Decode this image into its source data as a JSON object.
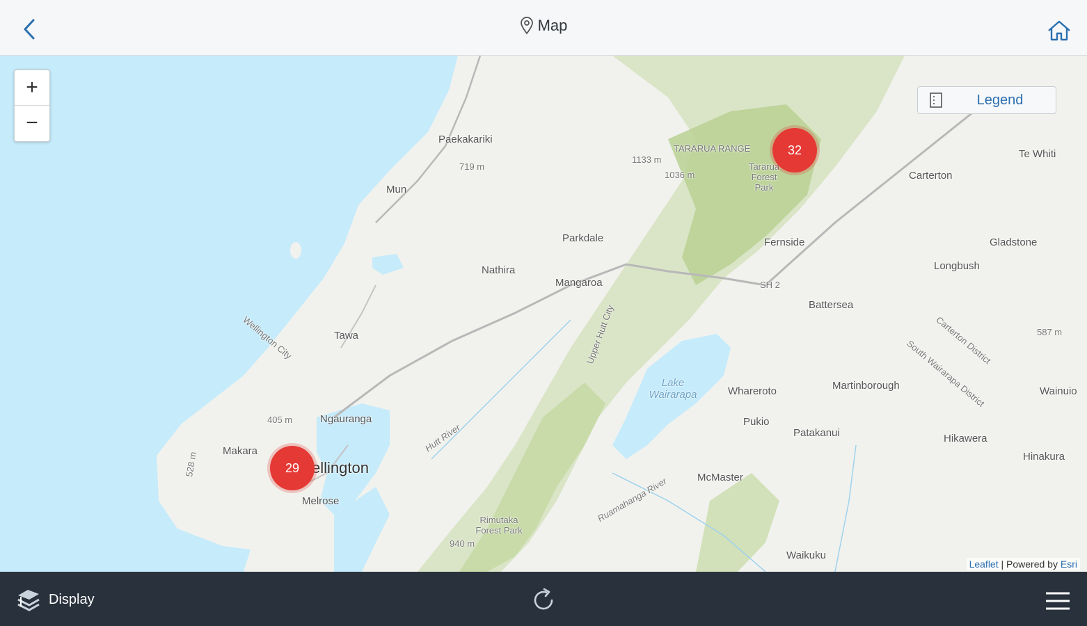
{
  "header": {
    "title": "Map"
  },
  "map": {
    "zoom_in_label": "+",
    "zoom_out_label": "−",
    "legend_label": "Legend",
    "clusters": [
      {
        "count": "32"
      },
      {
        "count": "29"
      }
    ],
    "places": {
      "paekakariki": "Paekakariki",
      "elev_719": "719 m",
      "mun": "Mun",
      "tararua_range": "TARARUA RANGE",
      "elev_1133": "1133 m",
      "elev_1036": "1036 m",
      "tararua_forest_park": "Tararua Forest Park",
      "parkdale": "Parkdale",
      "nathira": "Nathira",
      "mangaroa": "Mangaroa",
      "fernside": "Fernside",
      "carterton": "Carterton",
      "te_whiti": "Te Whiti",
      "gladstone": "Gladstone",
      "longbush": "Longbush",
      "sh2": "SH 2",
      "battersea": "Battersea",
      "tawa": "Tawa",
      "wellington_city": "Wellington City",
      "upper_hutt_city": "Upper Hutt City",
      "lake_wairarapa": "Lake Wairarapa",
      "whareroto": "Whareroto",
      "martinborough": "Martinborough",
      "pukio": "Pukio",
      "patakanui": "Patakanui",
      "hikawera": "Hikawera",
      "hinakura": "Hinakura",
      "wainuio": "Wainuio",
      "carterton_district": "Carterton District",
      "south_wairarapa_district": "South Wairarapa District",
      "elev_587": "587 m",
      "elev_405": "405 m",
      "ngauranga": "Ngauranga",
      "makara": "Makara",
      "wellington": "ellington",
      "melrose": "Melrose",
      "elev_528": "528 m",
      "mcmaster": "McMaster",
      "ruamahanga_river": "Ruamahanga River",
      "rimutaka_forest_park": "Rimutaka Forest Park",
      "elev_940": "940 m",
      "waikuku": "Waikuku",
      "hutt_river": "Hutt River"
    },
    "attribution": {
      "leaflet": "Leaflet",
      "separator": " | Powered by ",
      "esri": "Esri"
    }
  },
  "footer": {
    "display_label": "Display"
  },
  "colors": {
    "accent": "#2a6fb0",
    "cluster": "#e53935",
    "footer_bg": "#29323c",
    "water": "#c6ebfb"
  },
  "icons": {
    "back": "chevron-left-icon",
    "location": "map-pin-icon",
    "home": "home-icon",
    "legend": "list-icon",
    "display": "layers-icon",
    "refresh": "refresh-icon",
    "menu": "hamburger-menu-icon"
  }
}
